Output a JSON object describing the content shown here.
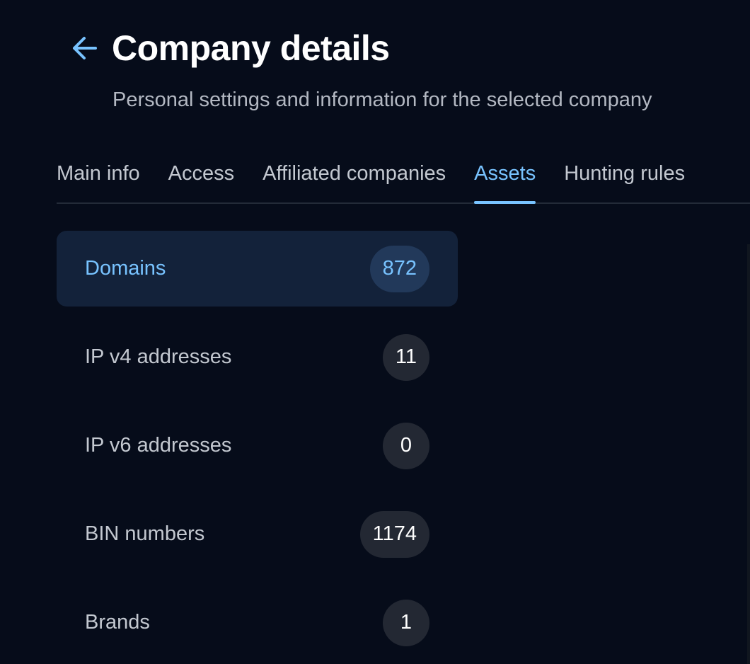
{
  "header": {
    "title": "Company details",
    "subtitle": "Personal settings and information for the selected company",
    "back_icon": "arrow-left-icon",
    "accent_color": "#78c3ff"
  },
  "tabs": [
    {
      "label": "Main info",
      "active": false
    },
    {
      "label": "Access",
      "active": false
    },
    {
      "label": "Affiliated companies",
      "active": false
    },
    {
      "label": "Assets",
      "active": true
    },
    {
      "label": "Hunting rules",
      "active": false
    }
  ],
  "assets": [
    {
      "label": "Domains",
      "count": "872",
      "selected": true
    },
    {
      "label": "IP v4 addresses",
      "count": "11",
      "selected": false
    },
    {
      "label": "IP v6 addresses",
      "count": "0",
      "selected": false
    },
    {
      "label": "BIN numbers",
      "count": "1174",
      "selected": false
    },
    {
      "label": "Brands",
      "count": "1",
      "selected": false
    }
  ]
}
